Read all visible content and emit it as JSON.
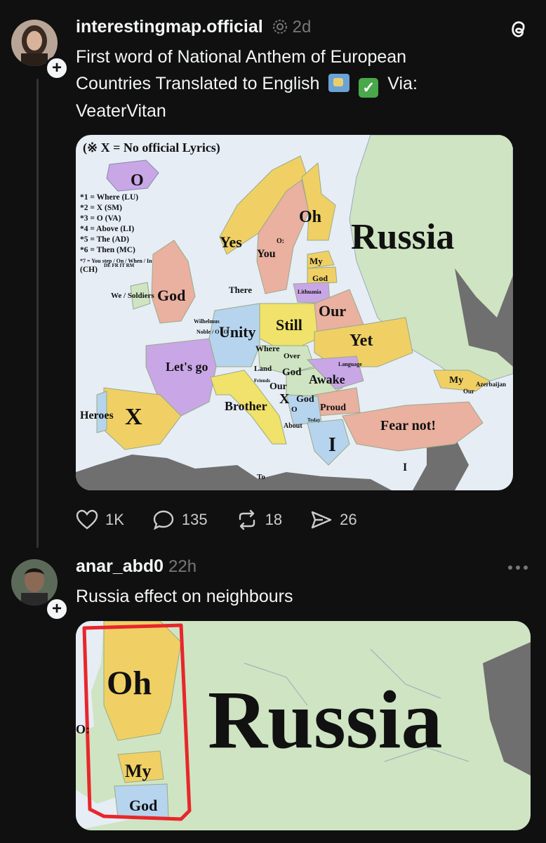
{
  "post1": {
    "username": "interestingmap.official",
    "time": "2d",
    "text_line1": "First word of National Anthem of European",
    "text_line2_a": "Countries Translated to English",
    "text_line2_b": "Via:",
    "text_line3": "VeaterVitan",
    "map": {
      "legend_title": "(※ X = No official Lyrics)",
      "legend": [
        "*1 = Where (LU)",
        "*2 = X (SM)",
        "*3 = O (VA)",
        "*4 = Above (LI)",
        "*5 = The (AD)",
        "*6 = Then (MC)",
        "*7 = You step / On / When / In"
      ],
      "legend_ch": "(CH)",
      "legend_langs": "DE      FR      IT      RM",
      "labels": {
        "iceland": "O",
        "norway": "Yes",
        "sweden": "You",
        "finland": "Oh",
        "russia": "Russia",
        "estonia": "My",
        "latvia": "God",
        "lithuania": "Lithuania",
        "denmark": "There",
        "uk": "God",
        "ireland": "We / Soldiers",
        "belarus": "Our",
        "poland": "Still",
        "netherlands": "Wilhelmus",
        "belgium": "Noble / O / O",
        "germany": "Unity",
        "ukraine": "Yet",
        "czech": "Where",
        "slovakia": "Over",
        "austria": "Land",
        "hungary": "God",
        "romania": "Awake",
        "moldova": "Language",
        "france": "Let's go",
        "switzerland": "Friends",
        "slovenia": "Our",
        "italy": "Brother",
        "croatia": "X",
        "serbia": "God",
        "bulgaria": "Proud",
        "bosnia": "O",
        "montenegro": "Today",
        "albania": "About",
        "greece": "I",
        "turkey": "Fear not!",
        "spain": "X",
        "portugal": "Heroes",
        "georgia": "My",
        "azerbaijan": "Azerbaijan",
        "armenia": "Our",
        "cyprus": "I",
        "malta": "To",
        "oslo_o": "O:"
      }
    },
    "actions": {
      "likes": "1K",
      "comments": "135",
      "reposts": "18",
      "shares": "26"
    }
  },
  "post2": {
    "username": "anar_abd0",
    "time": "22h",
    "text": "Russia effect on neighbours",
    "crop": {
      "russia": "Russia",
      "finland": "Oh",
      "estonia": "My",
      "latvia": "God",
      "o": "O:"
    }
  },
  "icons": {
    "verified": "verified-badge-icon",
    "threads": "threads-logo-icon",
    "more": "more-dots-icon",
    "map_emoji": "world-map-emoji",
    "check_emoji": "check-mark-emoji"
  },
  "colors": {
    "background": "#101010",
    "text": "#f3f5f7",
    "muted": "#777777",
    "sea": "#e6edf5",
    "russia": "#cfe4c2",
    "highlight": "#e8262b"
  }
}
